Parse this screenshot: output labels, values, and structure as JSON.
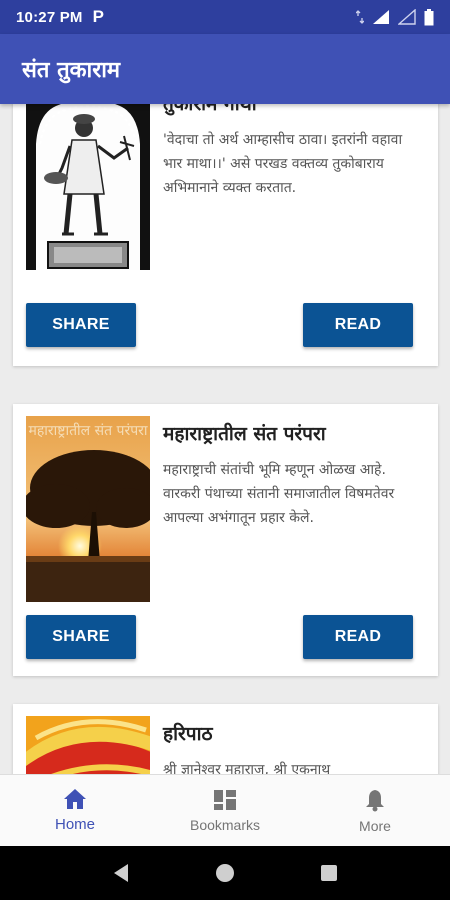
{
  "status_bar": {
    "time": "10:27 PM",
    "app_icon_letter": "P"
  },
  "app_bar": {
    "title": "संत तुकाराम"
  },
  "cards": [
    {
      "title": "तुकाराम गाथा",
      "description": "'वेदाचा तो अर्थ आम्हासीच ठावा। इतरांनी वहावा भार माथा।।' असे परखड वक्तव्य तुकोबाराय अभिमानाने व्यक्त करतात.",
      "share_label": "SHARE",
      "read_label": "READ"
    },
    {
      "title": "महाराष्ट्रातील संत परंपरा",
      "image_caption": "महाराष्ट्रातील संत परंपरा",
      "description": "महाराष्ट्राची संतांची भूमि म्हणून ओळख आहे. वारकरी पंथाच्या संतानी समाजातील विषमतेवर आपल्या अभंगातून प्रहार केले.",
      "share_label": "SHARE",
      "read_label": "READ"
    },
    {
      "title": "हरिपाठ",
      "description": "श्री ज्ञानेश्वर महाराज, श्री एकनाथ"
    }
  ],
  "bottom_nav": {
    "items": [
      {
        "label": "Home",
        "icon": "home-icon",
        "active": true
      },
      {
        "label": "Bookmarks",
        "icon": "bookmarks-icon",
        "active": false
      },
      {
        "label": "More",
        "icon": "bell-icon",
        "active": false
      }
    ]
  },
  "colors": {
    "status_bar": "#2e3f9e",
    "app_bar": "#3f51b5",
    "button": "#0b5394",
    "nav_active": "#3f51b5"
  }
}
